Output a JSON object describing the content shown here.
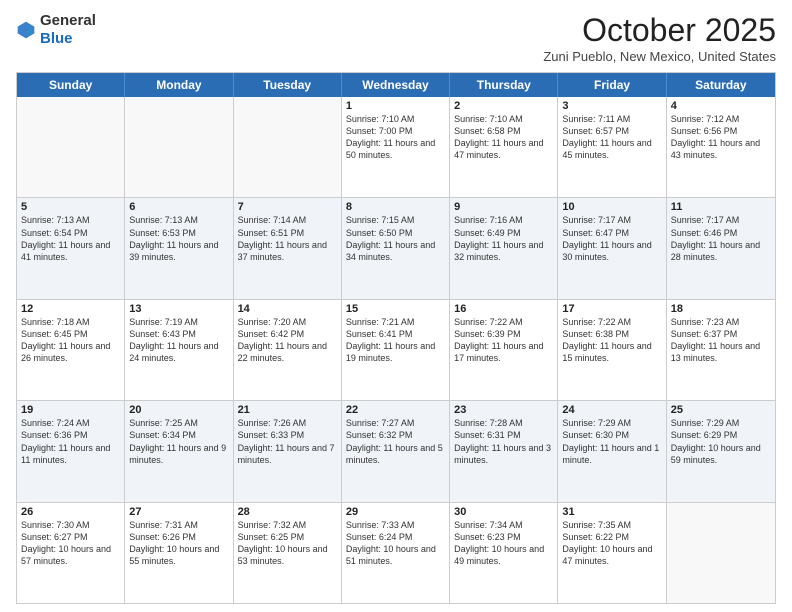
{
  "header": {
    "logo_general": "General",
    "logo_blue": "Blue",
    "month_title": "October 2025",
    "location": "Zuni Pueblo, New Mexico, United States"
  },
  "days_of_week": [
    "Sunday",
    "Monday",
    "Tuesday",
    "Wednesday",
    "Thursday",
    "Friday",
    "Saturday"
  ],
  "weeks": [
    [
      {
        "day": "",
        "text": ""
      },
      {
        "day": "",
        "text": ""
      },
      {
        "day": "",
        "text": ""
      },
      {
        "day": "1",
        "text": "Sunrise: 7:10 AM\nSunset: 7:00 PM\nDaylight: 11 hours and 50 minutes."
      },
      {
        "day": "2",
        "text": "Sunrise: 7:10 AM\nSunset: 6:58 PM\nDaylight: 11 hours and 47 minutes."
      },
      {
        "day": "3",
        "text": "Sunrise: 7:11 AM\nSunset: 6:57 PM\nDaylight: 11 hours and 45 minutes."
      },
      {
        "day": "4",
        "text": "Sunrise: 7:12 AM\nSunset: 6:56 PM\nDaylight: 11 hours and 43 minutes."
      }
    ],
    [
      {
        "day": "5",
        "text": "Sunrise: 7:13 AM\nSunset: 6:54 PM\nDaylight: 11 hours and 41 minutes."
      },
      {
        "day": "6",
        "text": "Sunrise: 7:13 AM\nSunset: 6:53 PM\nDaylight: 11 hours and 39 minutes."
      },
      {
        "day": "7",
        "text": "Sunrise: 7:14 AM\nSunset: 6:51 PM\nDaylight: 11 hours and 37 minutes."
      },
      {
        "day": "8",
        "text": "Sunrise: 7:15 AM\nSunset: 6:50 PM\nDaylight: 11 hours and 34 minutes."
      },
      {
        "day": "9",
        "text": "Sunrise: 7:16 AM\nSunset: 6:49 PM\nDaylight: 11 hours and 32 minutes."
      },
      {
        "day": "10",
        "text": "Sunrise: 7:17 AM\nSunset: 6:47 PM\nDaylight: 11 hours and 30 minutes."
      },
      {
        "day": "11",
        "text": "Sunrise: 7:17 AM\nSunset: 6:46 PM\nDaylight: 11 hours and 28 minutes."
      }
    ],
    [
      {
        "day": "12",
        "text": "Sunrise: 7:18 AM\nSunset: 6:45 PM\nDaylight: 11 hours and 26 minutes."
      },
      {
        "day": "13",
        "text": "Sunrise: 7:19 AM\nSunset: 6:43 PM\nDaylight: 11 hours and 24 minutes."
      },
      {
        "day": "14",
        "text": "Sunrise: 7:20 AM\nSunset: 6:42 PM\nDaylight: 11 hours and 22 minutes."
      },
      {
        "day": "15",
        "text": "Sunrise: 7:21 AM\nSunset: 6:41 PM\nDaylight: 11 hours and 19 minutes."
      },
      {
        "day": "16",
        "text": "Sunrise: 7:22 AM\nSunset: 6:39 PM\nDaylight: 11 hours and 17 minutes."
      },
      {
        "day": "17",
        "text": "Sunrise: 7:22 AM\nSunset: 6:38 PM\nDaylight: 11 hours and 15 minutes."
      },
      {
        "day": "18",
        "text": "Sunrise: 7:23 AM\nSunset: 6:37 PM\nDaylight: 11 hours and 13 minutes."
      }
    ],
    [
      {
        "day": "19",
        "text": "Sunrise: 7:24 AM\nSunset: 6:36 PM\nDaylight: 11 hours and 11 minutes."
      },
      {
        "day": "20",
        "text": "Sunrise: 7:25 AM\nSunset: 6:34 PM\nDaylight: 11 hours and 9 minutes."
      },
      {
        "day": "21",
        "text": "Sunrise: 7:26 AM\nSunset: 6:33 PM\nDaylight: 11 hours and 7 minutes."
      },
      {
        "day": "22",
        "text": "Sunrise: 7:27 AM\nSunset: 6:32 PM\nDaylight: 11 hours and 5 minutes."
      },
      {
        "day": "23",
        "text": "Sunrise: 7:28 AM\nSunset: 6:31 PM\nDaylight: 11 hours and 3 minutes."
      },
      {
        "day": "24",
        "text": "Sunrise: 7:29 AM\nSunset: 6:30 PM\nDaylight: 11 hours and 1 minute."
      },
      {
        "day": "25",
        "text": "Sunrise: 7:29 AM\nSunset: 6:29 PM\nDaylight: 10 hours and 59 minutes."
      }
    ],
    [
      {
        "day": "26",
        "text": "Sunrise: 7:30 AM\nSunset: 6:27 PM\nDaylight: 10 hours and 57 minutes."
      },
      {
        "day": "27",
        "text": "Sunrise: 7:31 AM\nSunset: 6:26 PM\nDaylight: 10 hours and 55 minutes."
      },
      {
        "day": "28",
        "text": "Sunrise: 7:32 AM\nSunset: 6:25 PM\nDaylight: 10 hours and 53 minutes."
      },
      {
        "day": "29",
        "text": "Sunrise: 7:33 AM\nSunset: 6:24 PM\nDaylight: 10 hours and 51 minutes."
      },
      {
        "day": "30",
        "text": "Sunrise: 7:34 AM\nSunset: 6:23 PM\nDaylight: 10 hours and 49 minutes."
      },
      {
        "day": "31",
        "text": "Sunrise: 7:35 AM\nSunset: 6:22 PM\nDaylight: 10 hours and 47 minutes."
      },
      {
        "day": "",
        "text": ""
      }
    ]
  ]
}
